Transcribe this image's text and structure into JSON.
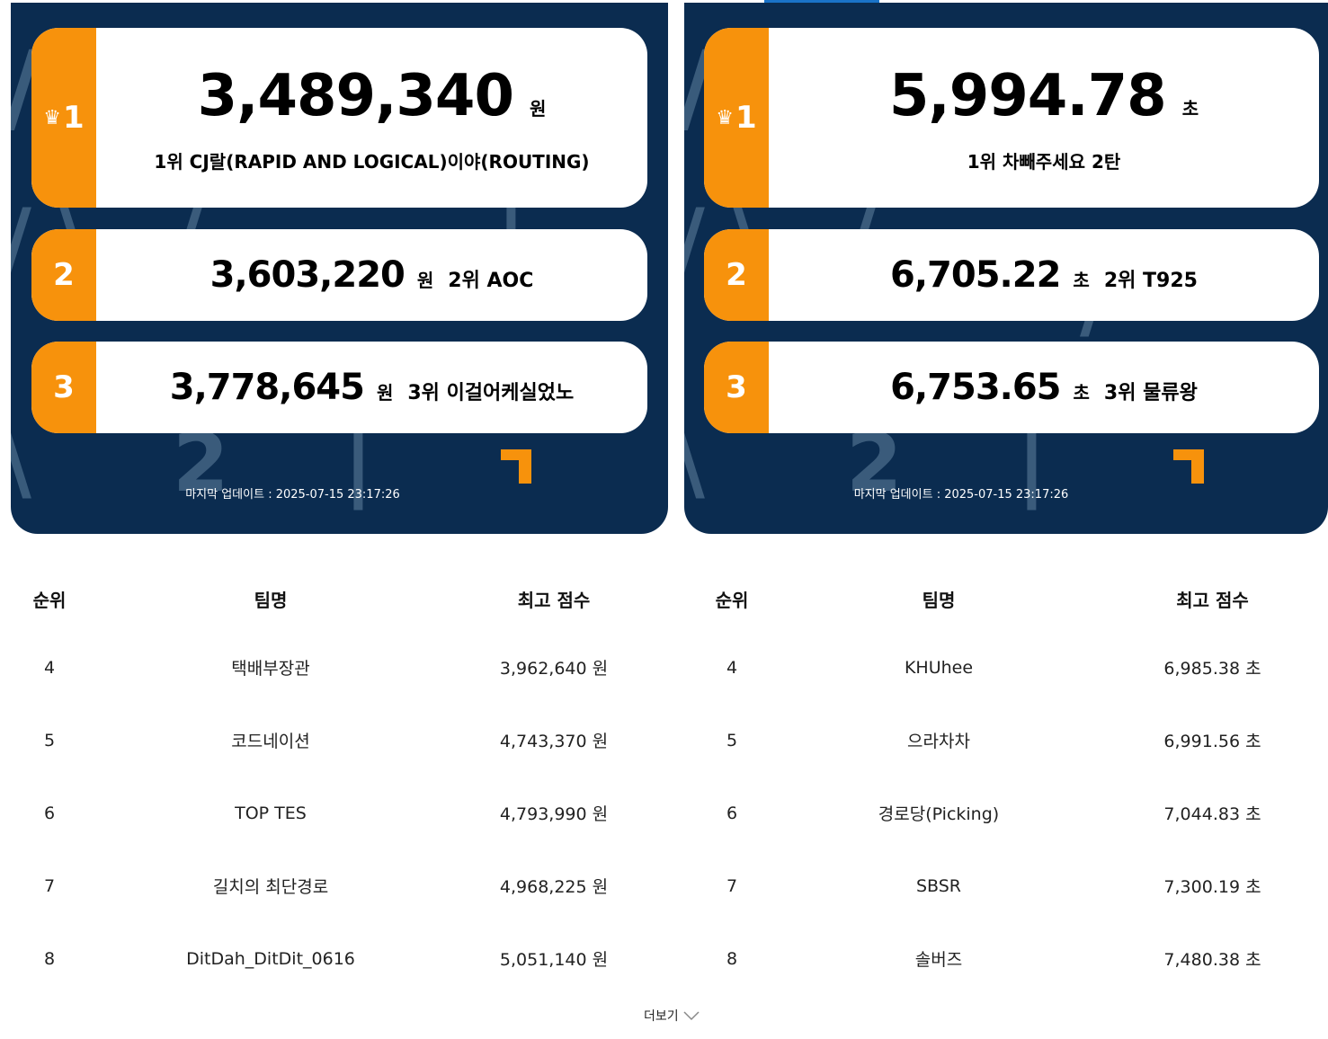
{
  "colors": {
    "panel_bg": "#0b2c50",
    "accent": "#f7920c",
    "tab_indicator": "#1a73c8"
  },
  "left": {
    "top": [
      {
        "rank": "1",
        "score": "3,489,340",
        "unit": "원",
        "team": "1위 CJ랄(RAPID AND LOGICAL)이야(ROUTING)"
      },
      {
        "rank": "2",
        "score": "3,603,220",
        "unit": "원",
        "team": "2위 AOC"
      },
      {
        "rank": "3",
        "score": "3,778,645",
        "unit": "원",
        "team": "3위 이걸어케실었노"
      }
    ],
    "updated": "마지막 업데이트 : 2025-07-15 23:17:26",
    "table": {
      "headers": [
        "순위",
        "팀명",
        "최고 점수"
      ],
      "rows": [
        [
          "4",
          "택배부장관",
          "3,962,640 원"
        ],
        [
          "5",
          "코드네이션",
          "4,743,370 원"
        ],
        [
          "6",
          "TOP TES",
          "4,793,990 원"
        ],
        [
          "7",
          "길치의 최단경로",
          "4,968,225 원"
        ],
        [
          "8",
          "DitDah_DitDit_0616",
          "5,051,140 원"
        ]
      ]
    }
  },
  "right": {
    "top": [
      {
        "rank": "1",
        "score": "5,994.78",
        "unit": "초",
        "team": "1위 차빼주세요 2탄"
      },
      {
        "rank": "2",
        "score": "6,705.22",
        "unit": "초",
        "team": "2위 T925"
      },
      {
        "rank": "3",
        "score": "6,753.65",
        "unit": "초",
        "team": "3위 물류왕"
      }
    ],
    "updated": "마지막 업데이트 : 2025-07-15 23:17:26",
    "table": {
      "headers": [
        "순위",
        "팀명",
        "최고 점수"
      ],
      "rows": [
        [
          "4",
          "KHUhee",
          "6,985.38 초"
        ],
        [
          "5",
          "으라차차",
          "6,991.56 초"
        ],
        [
          "6",
          "경로당(Picking)",
          "7,044.83 초"
        ],
        [
          "7",
          "SBSR",
          "7,300.19 초"
        ],
        [
          "8",
          "솔버즈",
          "7,480.38 초"
        ]
      ]
    }
  },
  "more_label": "더보기",
  "icons": {
    "crown": "crown-icon",
    "chevron": "chevron-down-icon",
    "logo": "brand-logo-mark"
  }
}
